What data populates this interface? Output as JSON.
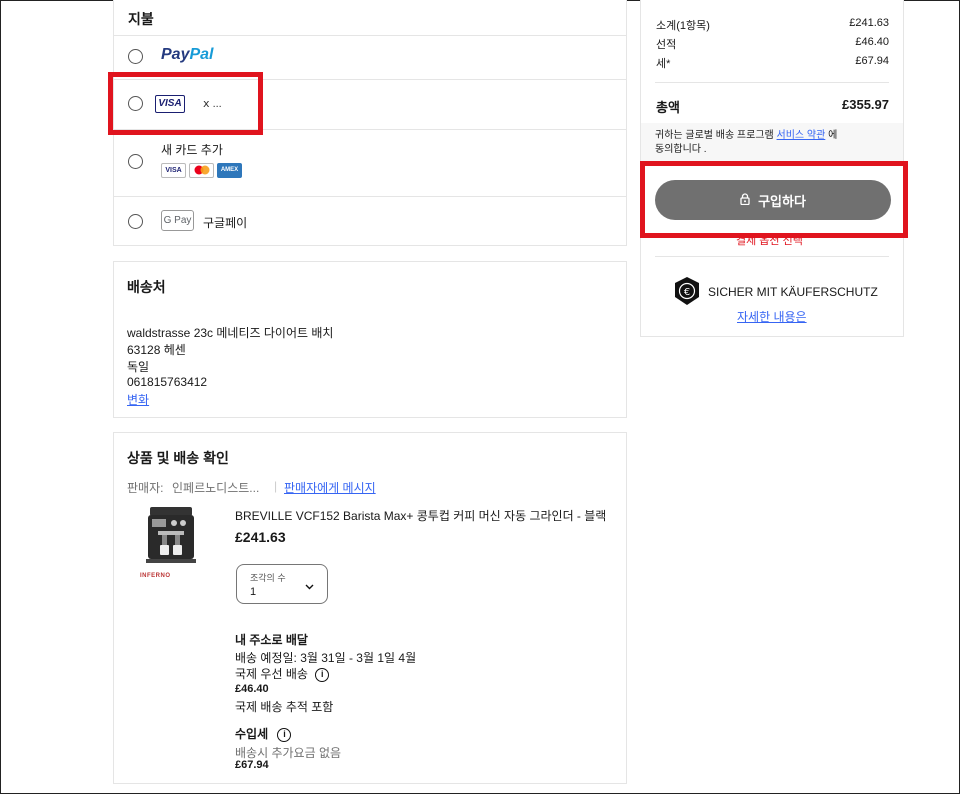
{
  "payment": {
    "title": "지불",
    "paypal_pay": "Pay",
    "paypal_pal": "Pal",
    "visa_label": "VISA",
    "visa_masked": "ⅹ ...",
    "new_card_label": "새 카드 추가",
    "card_brands": [
      "VISA",
      "MC",
      "AMEX"
    ],
    "gpay_logo": "G Pay",
    "gpay_label": "구글페이"
  },
  "shipping": {
    "title": "배송처",
    "address_lines": [
      "waldstrasse 23c 메네티즈 다이어트 배치",
      "63128 헤센",
      "독일",
      "061815763412"
    ],
    "change_link": "변화"
  },
  "review": {
    "title": "상품 및 배송 확인",
    "seller_label": "판매자:",
    "seller_name": "인페르노디스트...",
    "message_link": "판매자에게 메시지",
    "product_title": "BREVILLE VCF152 Barista Max+ 콩투컵 커피 머신 자동 그라인더 - 블랙",
    "product_price": "£241.63",
    "product_image_text": "INFERNO",
    "qty_label": "조각의 수",
    "qty_value": "1",
    "delivery_heading": "내 주소로 배달",
    "delivery_estimate": "배송 예정일: 3월 31일 - 3월 1일 4월",
    "shipping_method": "국제 우선 배송",
    "shipping_cost": "£46.40",
    "tracking": "국제 배송 추적 포함",
    "import_heading": "수입세",
    "import_note": "배송시 추가요금 없음",
    "import_cost": "£67.94"
  },
  "summary": {
    "subtotal_label": "소계(1항목)",
    "subtotal_value": "£241.63",
    "shipping_label": "선적",
    "shipping_value": "£46.40",
    "tax_label": "세*",
    "tax_value": "£67.94",
    "total_label": "총액",
    "total_value": "£355.97",
    "terms_pre": "귀하는 글로벌 배송 프로그램",
    "terms_link": "서비스 약관",
    "terms_post": "에",
    "terms_line2": "동의합니다 .",
    "buy_button": "구입하다",
    "hint_text": "결제 옵션 선택",
    "protection_label": "SICHER MIT KÄUFERSCHUTZ",
    "more_link": "자세한 내용은"
  },
  "colors": {
    "highlight": "#e0141e",
    "link": "#3665f3",
    "buy_button": "#707070"
  }
}
